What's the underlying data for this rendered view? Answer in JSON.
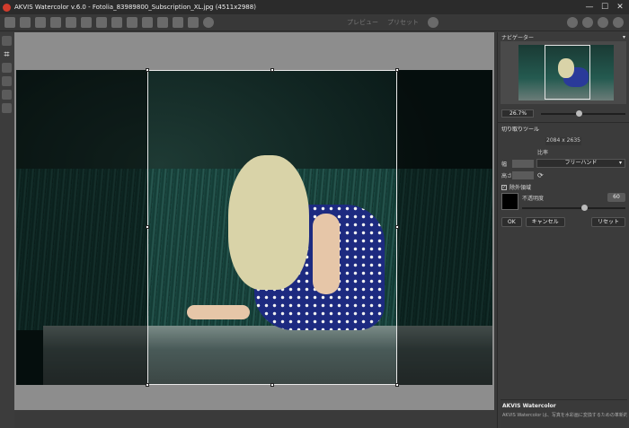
{
  "window": {
    "title": "AKVIS Watercolor v.6.0 - Fotolia_83989800_Subscription_XL.jpg (4511x2988)",
    "minimize": "—",
    "maximize": "☐",
    "close": "✕"
  },
  "toolbar": {
    "preview_label": "プレビュー",
    "result_label": "プリセット"
  },
  "navigator": {
    "title": "ナビゲーター",
    "zoom": "26.7%",
    "zoom_fraction": 0.45
  },
  "crop_tool": {
    "title": "切り取りツール",
    "dimensions": "2084 x 2635",
    "ratio_label": "比率",
    "width_label": "幅",
    "height_label": "高さ",
    "ratio_value": "フリーハンド",
    "outer_area_label": "除外領域",
    "outer_area_checked": "✓",
    "opacity_label": "不透明度",
    "opacity_value": "60",
    "opacity_fraction": 0.6,
    "swatch_color": "#000000"
  },
  "buttons": {
    "ok": "OK",
    "cancel": "キャンセル",
    "reset": "リセット"
  },
  "help": {
    "title": "AKVIS Watercolor",
    "text": "AKVIS Watercolor は、写真を水彩画に変換するための革新的なツールです。このソフトウェアがあれば、専門知"
  }
}
